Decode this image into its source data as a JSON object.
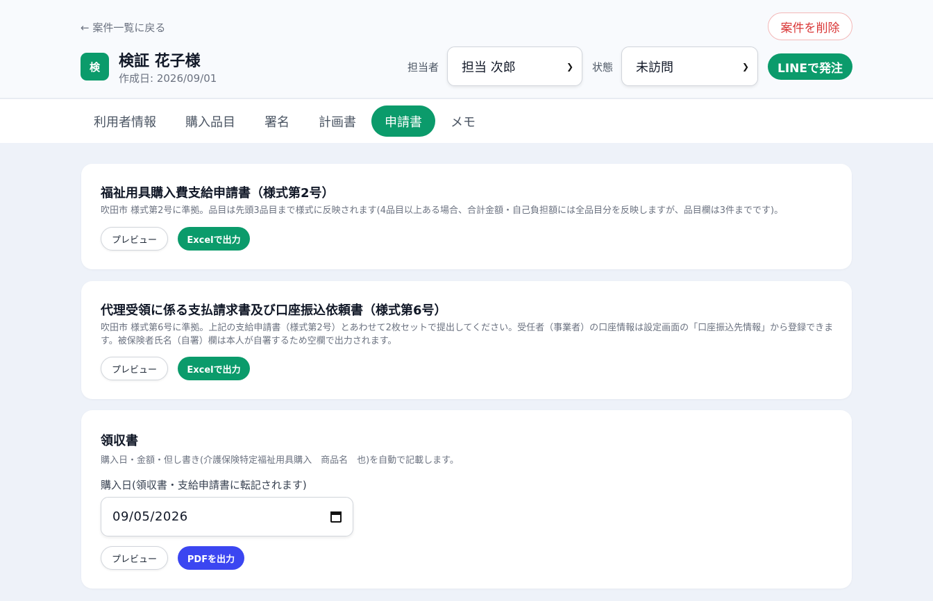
{
  "header": {
    "back_label": "← 案件一覧に戻る",
    "avatar_text": "検",
    "title": "検証 花子様",
    "created": "作成日: 2026/09/01",
    "delete_label": "案件を削除",
    "assignee_label": "担当者",
    "assignee_value": "担当 次郎",
    "status_label": "状態",
    "status_value": "未訪問",
    "line_label": "LINEで発注"
  },
  "tabs": [
    {
      "label": "利用者情報"
    },
    {
      "label": "購入品目"
    },
    {
      "label": "署名"
    },
    {
      "label": "計画書"
    },
    {
      "label": "申請書",
      "active": true
    },
    {
      "label": "メモ"
    }
  ],
  "cards": [
    {
      "title": "福祉用具購入費支給申請書（様式第2号）",
      "desc": "吹田市 様式第2号に準拠。品目は先頭3品目まで様式に反映されます(4品目以上ある場合、合計金額・自己負担額には全品目分を反映しますが、品目欄は3件までです)。",
      "preview_label": "プレビュー",
      "export_label": "Excelで出力"
    },
    {
      "title": "代理受領に係る支払請求書及び口座振込依頼書（様式第6号）",
      "desc": "吹田市 様式第6号に準拠。上記の支給申請書（様式第2号）とあわせて2枚セットで提出してください。受任者（事業者）の口座情報は設定画面の「口座振込先情報」から登録できます。被保険者氏名（自署）欄は本人が自署するため空欄で出力されます。",
      "preview_label": "プレビュー",
      "export_label": "Excelで出力"
    },
    {
      "title": "領収書",
      "desc": "購入日・金額・但し書き(介護保険特定福祉用具購入　商品名　也)を自動で記載します。",
      "date_label": "購入日(領収書・支給申請書に転記されます)",
      "date_value": "09/05/2026",
      "preview_label": "プレビュー",
      "export_label": "PDFを出力"
    }
  ],
  "colors": {
    "accent_green": "#0b9b6b",
    "accent_blue": "#3b46f1",
    "danger": "#d93636"
  },
  "icons": [
    "back-arrow-icon",
    "chevron-down-icon",
    "calendar-icon"
  ]
}
